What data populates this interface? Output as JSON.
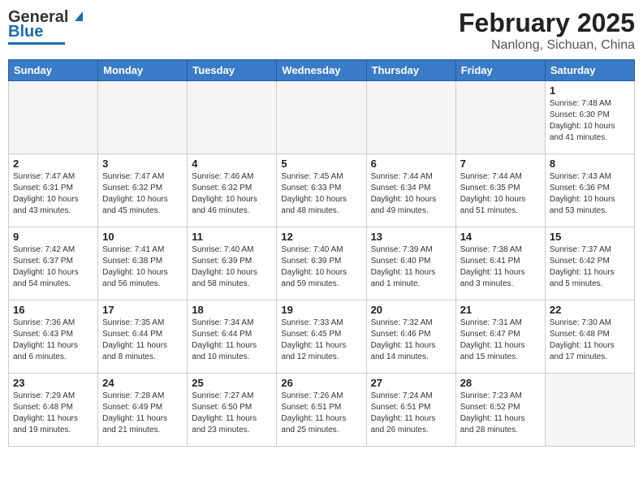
{
  "header": {
    "logo": {
      "general": "General",
      "blue": "Blue"
    },
    "title": "February 2025",
    "location": "Nanlong, Sichuan, China"
  },
  "days_of_week": [
    "Sunday",
    "Monday",
    "Tuesday",
    "Wednesday",
    "Thursday",
    "Friday",
    "Saturday"
  ],
  "weeks": [
    [
      {
        "day": "",
        "info": ""
      },
      {
        "day": "",
        "info": ""
      },
      {
        "day": "",
        "info": ""
      },
      {
        "day": "",
        "info": ""
      },
      {
        "day": "",
        "info": ""
      },
      {
        "day": "",
        "info": ""
      },
      {
        "day": "1",
        "info": "Sunrise: 7:48 AM\nSunset: 6:30 PM\nDaylight: 10 hours\nand 41 minutes."
      }
    ],
    [
      {
        "day": "2",
        "info": "Sunrise: 7:47 AM\nSunset: 6:31 PM\nDaylight: 10 hours\nand 43 minutes."
      },
      {
        "day": "3",
        "info": "Sunrise: 7:47 AM\nSunset: 6:32 PM\nDaylight: 10 hours\nand 45 minutes."
      },
      {
        "day": "4",
        "info": "Sunrise: 7:46 AM\nSunset: 6:32 PM\nDaylight: 10 hours\nand 46 minutes."
      },
      {
        "day": "5",
        "info": "Sunrise: 7:45 AM\nSunset: 6:33 PM\nDaylight: 10 hours\nand 48 minutes."
      },
      {
        "day": "6",
        "info": "Sunrise: 7:44 AM\nSunset: 6:34 PM\nDaylight: 10 hours\nand 49 minutes."
      },
      {
        "day": "7",
        "info": "Sunrise: 7:44 AM\nSunset: 6:35 PM\nDaylight: 10 hours\nand 51 minutes."
      },
      {
        "day": "8",
        "info": "Sunrise: 7:43 AM\nSunset: 6:36 PM\nDaylight: 10 hours\nand 53 minutes."
      }
    ],
    [
      {
        "day": "9",
        "info": "Sunrise: 7:42 AM\nSunset: 6:37 PM\nDaylight: 10 hours\nand 54 minutes."
      },
      {
        "day": "10",
        "info": "Sunrise: 7:41 AM\nSunset: 6:38 PM\nDaylight: 10 hours\nand 56 minutes."
      },
      {
        "day": "11",
        "info": "Sunrise: 7:40 AM\nSunset: 6:39 PM\nDaylight: 10 hours\nand 58 minutes."
      },
      {
        "day": "12",
        "info": "Sunrise: 7:40 AM\nSunset: 6:39 PM\nDaylight: 10 hours\nand 59 minutes."
      },
      {
        "day": "13",
        "info": "Sunrise: 7:39 AM\nSunset: 6:40 PM\nDaylight: 11 hours\nand 1 minute."
      },
      {
        "day": "14",
        "info": "Sunrise: 7:38 AM\nSunset: 6:41 PM\nDaylight: 11 hours\nand 3 minutes."
      },
      {
        "day": "15",
        "info": "Sunrise: 7:37 AM\nSunset: 6:42 PM\nDaylight: 11 hours\nand 5 minutes."
      }
    ],
    [
      {
        "day": "16",
        "info": "Sunrise: 7:36 AM\nSunset: 6:43 PM\nDaylight: 11 hours\nand 6 minutes."
      },
      {
        "day": "17",
        "info": "Sunrise: 7:35 AM\nSunset: 6:44 PM\nDaylight: 11 hours\nand 8 minutes."
      },
      {
        "day": "18",
        "info": "Sunrise: 7:34 AM\nSunset: 6:44 PM\nDaylight: 11 hours\nand 10 minutes."
      },
      {
        "day": "19",
        "info": "Sunrise: 7:33 AM\nSunset: 6:45 PM\nDaylight: 11 hours\nand 12 minutes."
      },
      {
        "day": "20",
        "info": "Sunrise: 7:32 AM\nSunset: 6:46 PM\nDaylight: 11 hours\nand 14 minutes."
      },
      {
        "day": "21",
        "info": "Sunrise: 7:31 AM\nSunset: 6:47 PM\nDaylight: 11 hours\nand 15 minutes."
      },
      {
        "day": "22",
        "info": "Sunrise: 7:30 AM\nSunset: 6:48 PM\nDaylight: 11 hours\nand 17 minutes."
      }
    ],
    [
      {
        "day": "23",
        "info": "Sunrise: 7:29 AM\nSunset: 6:48 PM\nDaylight: 11 hours\nand 19 minutes."
      },
      {
        "day": "24",
        "info": "Sunrise: 7:28 AM\nSunset: 6:49 PM\nDaylight: 11 hours\nand 21 minutes."
      },
      {
        "day": "25",
        "info": "Sunrise: 7:27 AM\nSunset: 6:50 PM\nDaylight: 11 hours\nand 23 minutes."
      },
      {
        "day": "26",
        "info": "Sunrise: 7:26 AM\nSunset: 6:51 PM\nDaylight: 11 hours\nand 25 minutes."
      },
      {
        "day": "27",
        "info": "Sunrise: 7:24 AM\nSunset: 6:51 PM\nDaylight: 11 hours\nand 26 minutes."
      },
      {
        "day": "28",
        "info": "Sunrise: 7:23 AM\nSunset: 6:52 PM\nDaylight: 11 hours\nand 28 minutes."
      },
      {
        "day": "",
        "info": ""
      }
    ]
  ]
}
